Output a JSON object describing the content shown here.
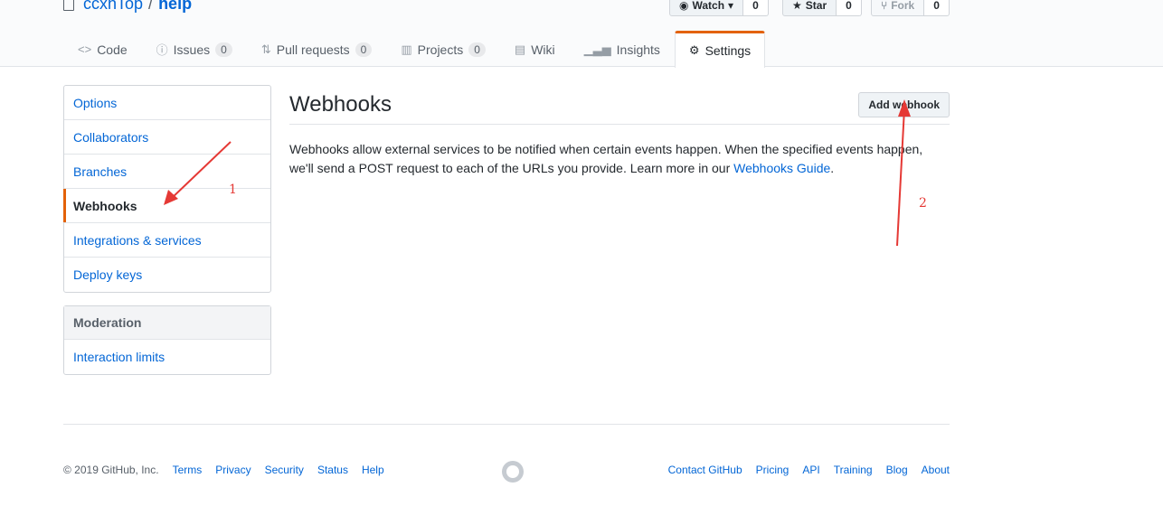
{
  "repo": {
    "owner": "ccxhTop",
    "separator": "/",
    "name": "help"
  },
  "actions": [
    {
      "label": "Watch",
      "count": "0",
      "icon": "eye-icon"
    },
    {
      "label": "Star",
      "count": "0",
      "icon": "star-icon"
    },
    {
      "label": "Fork",
      "count": "0",
      "icon": "fork-icon"
    }
  ],
  "tabs": [
    {
      "label": "Code",
      "icon": "code-icon",
      "counter": ""
    },
    {
      "label": "Issues",
      "icon": "issue-icon",
      "counter": "0"
    },
    {
      "label": "Pull requests",
      "icon": "pull-request-icon",
      "counter": "0"
    },
    {
      "label": "Projects",
      "icon": "project-icon",
      "counter": "0"
    },
    {
      "label": "Wiki",
      "icon": "book-icon",
      "counter": ""
    },
    {
      "label": "Insights",
      "icon": "graph-icon",
      "counter": ""
    },
    {
      "label": "Settings",
      "icon": "gear-icon",
      "counter": ""
    }
  ],
  "sidebar": {
    "items": [
      "Options",
      "Collaborators",
      "Branches",
      "Webhooks",
      "Integrations & services",
      "Deploy keys"
    ],
    "moderation": {
      "heading": "Moderation",
      "items": [
        "Interaction limits"
      ]
    }
  },
  "main": {
    "title": "Webhooks",
    "add_button": "Add webhook",
    "description": "Webhooks allow external services to be notified when certain events happen. When the specified events happen, we'll send a POST request to each of the URLs you provide. Learn more in our ",
    "link": "Webhooks Guide",
    "period": "."
  },
  "footer": {
    "copyright": "© 2019 GitHub, Inc.",
    "left_links": [
      "Terms",
      "Privacy",
      "Security",
      "Status",
      "Help"
    ],
    "right_links": [
      "Contact GitHub",
      "Pricing",
      "API",
      "Training",
      "Blog",
      "About"
    ]
  },
  "annotations": {
    "label1": "1",
    "label2": "2",
    "color": "#e53935"
  },
  "colors": {
    "link": "#0366d6",
    "accent": "#e36209"
  }
}
